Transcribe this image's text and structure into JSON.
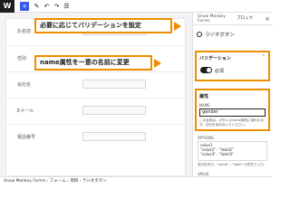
{
  "toolbar": {
    "logo": "W",
    "add_label": "+",
    "edit_label": "✎",
    "undo_label": "↶",
    "redo_label": "↷",
    "list_label": "☰"
  },
  "form": {
    "rows": [
      {
        "label": "お名前",
        "type": "text"
      },
      {
        "label": "性別",
        "type": "radio",
        "options": [
          "value1",
          "label2",
          "label3"
        ]
      },
      {
        "label": "会社名",
        "type": "text"
      },
      {
        "label": "Eメール",
        "type": "text"
      },
      {
        "label": "電話番号",
        "type": "text"
      }
    ]
  },
  "callouts": {
    "validation": "必要に応じてバリデーションを設定",
    "name": "name属性を一意の名前に変更"
  },
  "sidebar": {
    "tab_block_plugin": "Snow Monkey Forms",
    "tab_block": "ブロック",
    "close": "×",
    "block_name": "ラジオボタン",
    "validation": {
      "title": "バリデーション",
      "toggle_label": "必須"
    },
    "attributes": {
      "title": "属性",
      "name_label": "NAME",
      "name_value": "gender",
      "name_help": "この名前は、ボタンのname属性に使われます。空白を含めないでください。"
    },
    "options": {
      "label": "OPTIONS",
      "value": "value1\n\"value2\" : \"label2\"\n\"value3\" : \"label3\"",
      "help": "改行区切り。\"value\" : \"label\" の形式で入力"
    },
    "value_label": "VALUE"
  },
  "footer": {
    "breadcrumb": "Snow Monkey Forms  ›  フォーム  ›  項目  ›  ラジオボタン"
  }
}
